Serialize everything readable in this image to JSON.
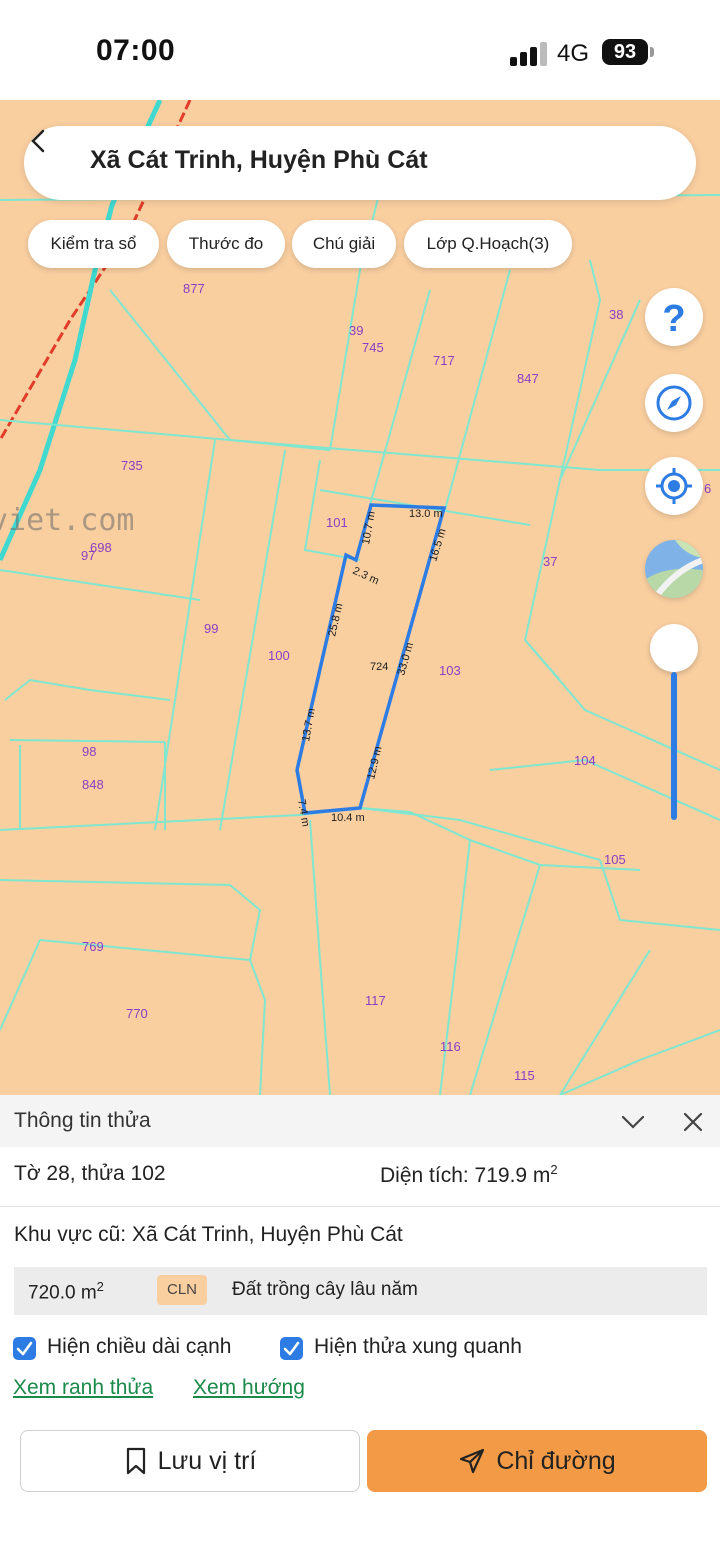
{
  "status_bar": {
    "time": "07:00",
    "network": "4G",
    "battery": "93"
  },
  "search": {
    "title": "Xã Cát Trinh, Huyện Phù Cát"
  },
  "chips": [
    "Kiểm tra sổ",
    "Thước đo",
    "Chú giải",
    "Lớp Q.Hoạch(3)"
  ],
  "map": {
    "watermark": "viet.com",
    "parcels": [
      "877",
      "39",
      "745",
      "717",
      "847",
      "38",
      "735",
      "101",
      "97",
      "698",
      "37",
      "99",
      "100",
      "724",
      "103",
      "98",
      "848",
      "104",
      "105",
      "769",
      "770",
      "117",
      "116",
      "115",
      "6"
    ],
    "edges": [
      "13.0 m",
      "10.7 m",
      "16.5 m",
      "2.3 m",
      "25.8 m",
      "33.0 m",
      "13.7 m",
      "12.9 m",
      "7.4 m",
      "10.4 m"
    ]
  },
  "info": {
    "header": "Thông tin thửa",
    "sheet_plot": "Tờ 28, thửa 102",
    "area_label": "Diện tích: 719.9 m",
    "area_sup": "2",
    "region": "Khu vực cũ: Xã Cát Trinh, Huyện Phù Cát",
    "landuse_area": "720.0 m",
    "landuse_sup": "2",
    "landuse_code": "CLN",
    "landuse_name": "Đất trồng cây lâu năm",
    "check_edges": "Hiện chiều dài cạnh",
    "check_neighbors": "Hiện thửa xung quanh",
    "link_boundary": "Xem ranh thửa",
    "link_direction": "Xem hướng",
    "btn_save": "Lưu vị trí",
    "btn_route": "Chỉ đường"
  },
  "colors": {
    "map_bg": "#f9cfa0",
    "parcel_line": "#7fe6d0",
    "selected_outline": "#2d7ce4",
    "road": "#e23b2a",
    "route_button": "#f29a45",
    "link": "#1a8a4a"
  }
}
